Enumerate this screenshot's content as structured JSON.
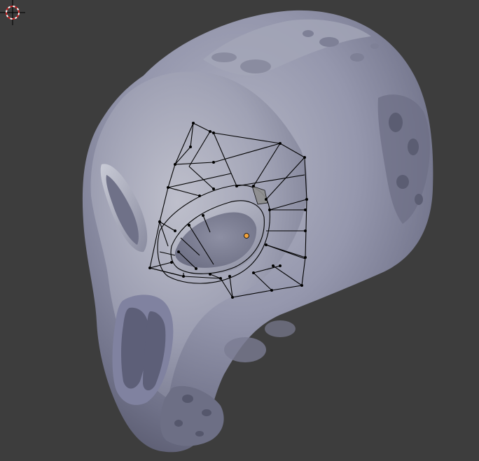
{
  "viewport": {
    "background_color": "#3d3d3d",
    "mesh_color": "#8f91a8",
    "wire_color": "#000000",
    "origin_color": "#f2a23a",
    "cursor_ring_colors": [
      "#cc2222",
      "#ffffff"
    ]
  },
  "scene": {
    "object": "skull-sculpt",
    "mode": "edit",
    "icons": [
      "3d-cursor-icon",
      "object-origin-icon"
    ]
  }
}
